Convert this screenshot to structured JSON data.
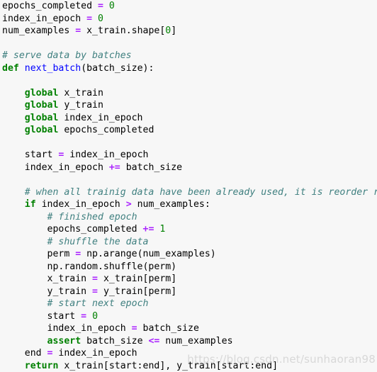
{
  "editor": {
    "background_color": "#f7f7f7",
    "language": "python",
    "palette": {
      "plain": "#000000",
      "keyword": "#008000",
      "function": "#0000ff",
      "comment": "#408080",
      "operator": "#aa22ff",
      "number": "#008000"
    }
  },
  "watermark": {
    "text": "https://blog.csdn.net/sunhaoran98",
    "color": "#d8d8d8"
  },
  "code": {
    "lines": [
      [
        {
          "t": "epochs_completed ",
          "c": "plain"
        },
        {
          "t": "=",
          "c": "operator"
        },
        {
          "t": " ",
          "c": "plain"
        },
        {
          "t": "0",
          "c": "number"
        }
      ],
      [
        {
          "t": "index_in_epoch ",
          "c": "plain"
        },
        {
          "t": "=",
          "c": "operator"
        },
        {
          "t": " ",
          "c": "plain"
        },
        {
          "t": "0",
          "c": "number"
        }
      ],
      [
        {
          "t": "num_examples ",
          "c": "plain"
        },
        {
          "t": "=",
          "c": "operator"
        },
        {
          "t": " x_train.shape[",
          "c": "plain"
        },
        {
          "t": "0",
          "c": "number"
        },
        {
          "t": "]",
          "c": "plain"
        }
      ],
      [],
      [
        {
          "t": "# serve data by batches",
          "c": "comment"
        }
      ],
      [
        {
          "t": "def",
          "c": "keyword"
        },
        {
          "t": " ",
          "c": "plain"
        },
        {
          "t": "next_batch",
          "c": "function"
        },
        {
          "t": "(batch_size):",
          "c": "plain"
        }
      ],
      [],
      [
        {
          "t": "    ",
          "c": "plain"
        },
        {
          "t": "global",
          "c": "keyword"
        },
        {
          "t": " x_train",
          "c": "plain"
        }
      ],
      [
        {
          "t": "    ",
          "c": "plain"
        },
        {
          "t": "global",
          "c": "keyword"
        },
        {
          "t": " y_train",
          "c": "plain"
        }
      ],
      [
        {
          "t": "    ",
          "c": "plain"
        },
        {
          "t": "global",
          "c": "keyword"
        },
        {
          "t": " index_in_epoch",
          "c": "plain"
        }
      ],
      [
        {
          "t": "    ",
          "c": "plain"
        },
        {
          "t": "global",
          "c": "keyword"
        },
        {
          "t": " epochs_completed",
          "c": "plain"
        }
      ],
      [],
      [
        {
          "t": "    start ",
          "c": "plain"
        },
        {
          "t": "=",
          "c": "operator"
        },
        {
          "t": " index_in_epoch",
          "c": "plain"
        }
      ],
      [
        {
          "t": "    index_in_epoch ",
          "c": "plain"
        },
        {
          "t": "+=",
          "c": "operator"
        },
        {
          "t": " batch_size",
          "c": "plain"
        }
      ],
      [],
      [
        {
          "t": "    ",
          "c": "plain"
        },
        {
          "t": "# when all trainig data have been already used, it is reorder randomly",
          "c": "comment"
        }
      ],
      [
        {
          "t": "    ",
          "c": "plain"
        },
        {
          "t": "if",
          "c": "keyword"
        },
        {
          "t": " index_in_epoch ",
          "c": "plain"
        },
        {
          "t": ">",
          "c": "operator"
        },
        {
          "t": " num_examples:",
          "c": "plain"
        }
      ],
      [
        {
          "t": "        ",
          "c": "plain"
        },
        {
          "t": "# finished epoch",
          "c": "comment"
        }
      ],
      [
        {
          "t": "        epochs_completed ",
          "c": "plain"
        },
        {
          "t": "+=",
          "c": "operator"
        },
        {
          "t": " ",
          "c": "plain"
        },
        {
          "t": "1",
          "c": "number"
        }
      ],
      [
        {
          "t": "        ",
          "c": "plain"
        },
        {
          "t": "# shuffle the data",
          "c": "comment"
        }
      ],
      [
        {
          "t": "        perm ",
          "c": "plain"
        },
        {
          "t": "=",
          "c": "operator"
        },
        {
          "t": " np.arange(num_examples)",
          "c": "plain"
        }
      ],
      [
        {
          "t": "        np.random.shuffle(perm)",
          "c": "plain"
        }
      ],
      [
        {
          "t": "        x_train ",
          "c": "plain"
        },
        {
          "t": "=",
          "c": "operator"
        },
        {
          "t": " x_train[perm]",
          "c": "plain"
        }
      ],
      [
        {
          "t": "        y_train ",
          "c": "plain"
        },
        {
          "t": "=",
          "c": "operator"
        },
        {
          "t": " y_train[perm]",
          "c": "plain"
        }
      ],
      [
        {
          "t": "        ",
          "c": "plain"
        },
        {
          "t": "# start next epoch",
          "c": "comment"
        }
      ],
      [
        {
          "t": "        start ",
          "c": "plain"
        },
        {
          "t": "=",
          "c": "operator"
        },
        {
          "t": " ",
          "c": "plain"
        },
        {
          "t": "0",
          "c": "number"
        }
      ],
      [
        {
          "t": "        index_in_epoch ",
          "c": "plain"
        },
        {
          "t": "=",
          "c": "operator"
        },
        {
          "t": " batch_size",
          "c": "plain"
        }
      ],
      [
        {
          "t": "        ",
          "c": "plain"
        },
        {
          "t": "assert",
          "c": "keyword"
        },
        {
          "t": " batch_size ",
          "c": "plain"
        },
        {
          "t": "<=",
          "c": "operator"
        },
        {
          "t": " num_examples",
          "c": "plain"
        }
      ],
      [
        {
          "t": "    end ",
          "c": "plain"
        },
        {
          "t": "=",
          "c": "operator"
        },
        {
          "t": " index_in_epoch",
          "c": "plain"
        }
      ],
      [
        {
          "t": "    ",
          "c": "plain"
        },
        {
          "t": "return",
          "c": "keyword"
        },
        {
          "t": " x_train[start:end], y_train[start:end]",
          "c": "plain"
        }
      ]
    ]
  }
}
